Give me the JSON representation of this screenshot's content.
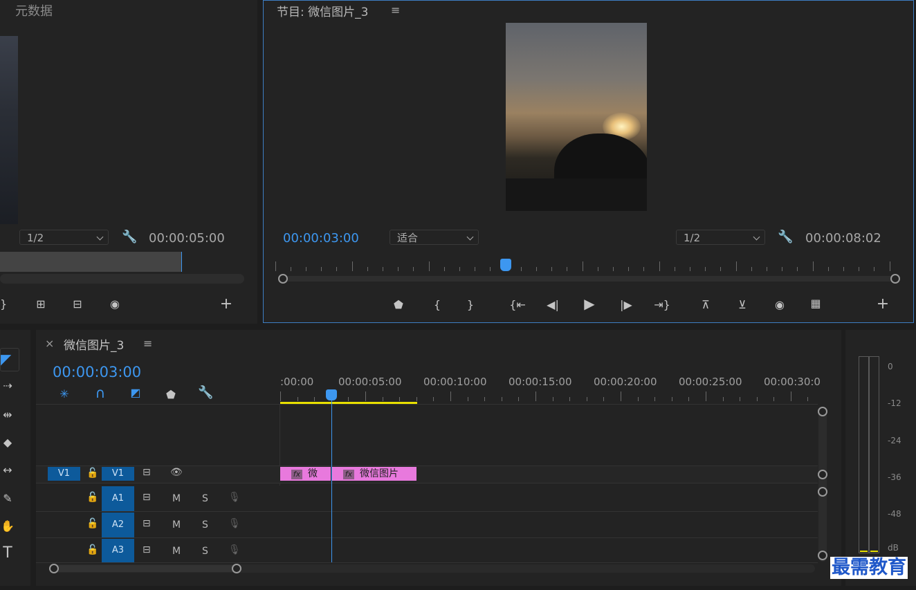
{
  "source_panel": {
    "title": "元数据",
    "scale": "1/2",
    "timecode": "00:00:05:00"
  },
  "program_panel": {
    "title": "节目: 微信图片_3",
    "menu_icon": "hamburger-icon",
    "timecode": "00:00:03:00",
    "fit": "适合",
    "scale": "1/2",
    "duration": "00:00:08:02"
  },
  "timeline": {
    "tab_title": "微信图片_3",
    "close": "×",
    "timecode": "00:00:03:00",
    "ruler": [
      ":00:00",
      "00:00:05:00",
      "00:00:10:00",
      "00:00:15:00",
      "00:00:20:00",
      "00:00:25:00",
      "00:00:30:0"
    ],
    "tracks": {
      "video": {
        "src": "V1",
        "target": "V1"
      },
      "audio": [
        {
          "name": "A1",
          "m": "M",
          "s": "S"
        },
        {
          "name": "A2",
          "m": "M",
          "s": "S"
        },
        {
          "name": "A3",
          "m": "M",
          "s": "S"
        }
      ]
    },
    "clips": [
      {
        "fx": "fx",
        "label": "微"
      },
      {
        "fx": "fx",
        "label": "微信图片"
      }
    ]
  },
  "meter": {
    "labels": [
      "0",
      "-12",
      "-24",
      "-36",
      "-48",
      "dB"
    ]
  },
  "watermark": "最需教育",
  "colors": {
    "accent": "#3d97f0",
    "clip": "#e879dd",
    "track_tag": "#0d5a9b",
    "work_area": "#e8e000"
  }
}
